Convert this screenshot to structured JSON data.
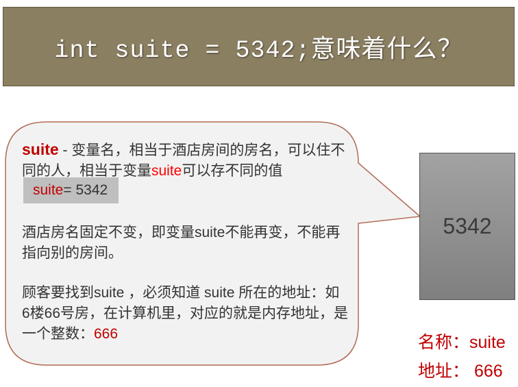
{
  "title": {
    "code": "int suite = 5342;",
    "question": "意味着什么？"
  },
  "callout": {
    "para1": {
      "keyword": "suite",
      "text_a": " - 变量名，相当于酒店房间的房名，可以住不同的人，相当于变量",
      "keyword_inline": "suite",
      "text_b": "可以存不同的值",
      "chip_var": "suite",
      "chip_rest": "= 5342"
    },
    "para2": "酒店房名固定不变，即变量suite不能再变，不能再指向别的房间。",
    "para3": {
      "text": "顾客要找到suite ，必须知道 suite 所在的地址：如 6楼66号房，在计算机里，对应的就是内存地址，是一个整数：",
      "address": "666"
    }
  },
  "memory_cell": {
    "value": "5342"
  },
  "labels": {
    "name_label": "名称：suite",
    "address_label": "地址： 666"
  },
  "colors": {
    "title_bg": "#8b7f62",
    "callout_bg": "#f2f2f2",
    "callout_border": "#b06a55",
    "highlight_red": "#c00000",
    "memory_cell_top": "#a3a3a3",
    "memory_cell_bottom": "#7f7f7f"
  }
}
